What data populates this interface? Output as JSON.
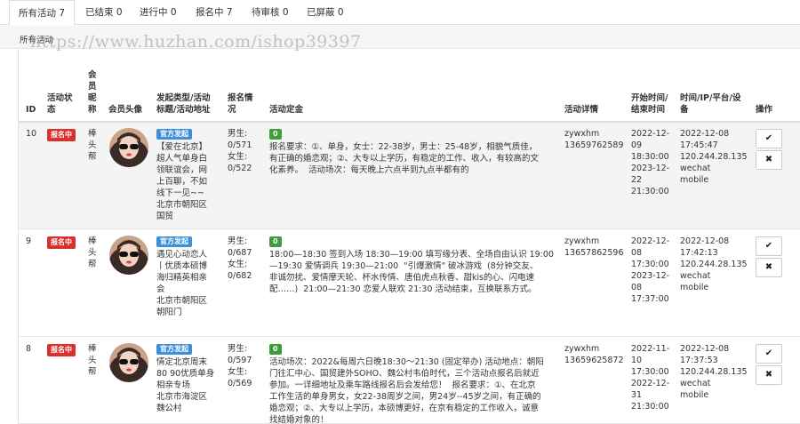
{
  "tabs": [
    {
      "label": "所有活动 7"
    },
    {
      "label": "已结束 0"
    },
    {
      "label": "进行中 0"
    },
    {
      "label": "报名中 7"
    },
    {
      "label": "待审核 0"
    },
    {
      "label": "已屏蔽 0"
    }
  ],
  "breadcrumb": "所有活动",
  "watermark": "https://www.huzhan.com/ishop39397",
  "columns": {
    "id": "ID",
    "status": "活动状\n态",
    "nickname": "会\n员\n昵\n称",
    "avatar": "会员头像",
    "type": "发起类型/活动\n标题/活动地址",
    "signup": "报名情\n况",
    "fee": "活动定金",
    "detail": "活动详情",
    "time": "开始时间/\n结束时间",
    "meta": "时间/IP/平台/设\n备",
    "ops": "操作"
  },
  "rows": [
    {
      "id": "10",
      "status": "报名中",
      "nickname": "棒\n头\n帮",
      "type_badge": "官方发起",
      "title": "【爱在北京】\n超人气单身白\n领联谊会，网\n上百聊，不如\n线下一见~~\n北京市朝阳区\n国贸",
      "signup": "男生:\n0/571\n女生:\n0/522",
      "fee": "0",
      "content": "报名要求：①、单身，女士：22-38岁，男士：25-48岁，相貌气质佳，\n有正确的婚恋观；②、大专以上学历，有稳定的工作、收入，有较高的文\n化素养。  活动场次：每天晚上六点半到九点半都有的",
      "detail": "zywxhm\n13659762589",
      "time": "2022-12-\n09\n18:30:00\n2023-12-\n22\n21:30:00",
      "meta": "2022-12-08\n17:45:47\n120.244.28.135\nwechat\nmobile"
    },
    {
      "id": "9",
      "status": "报名中",
      "nickname": "棒\n头\n帮",
      "type_badge": "官方发起",
      "title": "遇见心动恋人\n丨优质本硕博\n海归精英相亲\n会\n北京市朝阳区\n朝阳门",
      "signup": "男生:\n0/687\n女生:\n0/682",
      "fee": "0",
      "content": "18:00—18:30 签到入场 18:30—19:00 填写缘分表、全场自由认识 19:00\n—19:30 爱情调兵 19:30—21:00  \"引爆激情\" 破冰游戏  (8分钟交友、\n非诚勿扰、爱情摩天轮、杯水传情、唐伯虎点秋香、甜kis的心、闪电速\n配……)  21:00—21:30 恋爱人联欢 21:30 活动结束，互换联系方式。",
      "detail": "zywxhm\n13657862596",
      "time": "2022-12-\n08\n17:30:00\n2023-12-\n08\n17:37:00",
      "meta": "2022-12-08\n17:42:13\n120.244.28.135\nwechat\nmobile"
    },
    {
      "id": "8",
      "status": "报名中",
      "nickname": "棒\n头\n帮",
      "type_badge": "官方发起",
      "title": "情定北京周末\n80 90优质单身\n相亲专场\n北京市海淀区\n魏公村",
      "signup": "男生:\n0/597\n女生:\n0/569",
      "fee": "0",
      "content": "活动场次：2022&每周六日晚18:30～21:30 (固定举办) 活动地点：朝阳\n门往汇中心、国贸建外SOHO、魏公村韦伯时代，三个活动点报名后就近\n参加。一详细地址及乘车路线报名后会发给您！  报名要求：①、在北京\n工作生活的单身男女，女22-38周岁之间，男24岁--45岁之间，有正确的\n婚恋观；②、大专以上学历，本硕博更好，在京有稳定的工作收入，诚意\n找结婚对象的！",
      "detail": "zywxhm\n13659625872",
      "time": "2022-11-\n10\n17:30:00\n2022-12-\n31\n21:30:00",
      "meta": "2022-12-08\n17:37:53\n120.244.28.135\nwechat\nmobile"
    }
  ],
  "ops": {
    "approve_icon": "check-icon",
    "reject_icon": "x-icon",
    "approve_glyph": "✔",
    "reject_glyph": "✖"
  },
  "colors": {
    "status_red": "#d9302b",
    "official_blue": "#3d8fd9",
    "fee_green": "#3c9d3c"
  }
}
